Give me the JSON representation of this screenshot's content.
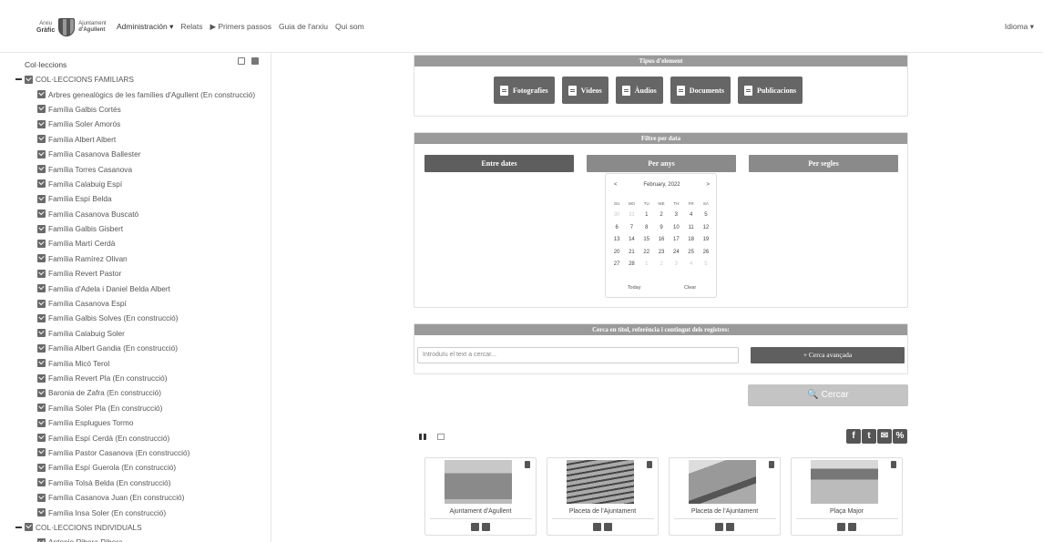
{
  "navbar": {
    "logo_line1": "Arxiu",
    "logo_line2": "Gràfic",
    "logo_line3": "Ajuntament",
    "logo_line4": "d'Agullent",
    "admin": "Administración ▾",
    "links": [
      "Relats",
      "▶ Primers passos",
      "Guia de l'arxiu",
      "Qui som"
    ],
    "language": "Idioma ▾"
  },
  "sidebar": {
    "title": "Col·leccions",
    "group1": "COL·LECCIONS FAMILIARS",
    "group1_items": [
      "Arbres genealògics de les famílies d'Agullent (En construcció)",
      "Família Galbis Cortés",
      "Família Soler Amorós",
      "Família Albert Albert",
      "Família Casanova Ballester",
      "Família Torres Casanova",
      "Família Calabuig Espí",
      "Família Espí Belda",
      "Família Casanova Buscató",
      "Família Galbis Gisbert",
      "Família Martí Cerdà",
      "Família Ramírez Olivan",
      "Família Revert Pastor",
      "Família d'Adela i Daniel Belda Albert",
      "Família Casanova Espí",
      "Família Galbis Solves (En construcció)",
      "Família Calabuig Soler",
      "Família Albert Gandia (En construcció)",
      "Família Micó Terol",
      "Família Revert Pla (En construcció)",
      "Baronia de Zafra (En construcció)",
      "Família Soler Pla (En construcció)",
      "Família Esplugues Tormo",
      "Família Espí Cerdà (En construcció)",
      "Família Pastor Casanova (En construcció)",
      "Família Espí Guerola (En construcció)",
      "Família Tolsà Belda (En construcció)",
      "Família Casanova Juan (En construcció)",
      "Família Insa Soler (En construcció)"
    ],
    "group2": "COL·LECCIONS INDIVIDUALS",
    "group2_items": [
      "Antonio Ribera Ribera"
    ]
  },
  "types": {
    "header": "Tipus d'element",
    "buttons": [
      "Fotografies",
      "Vídeos",
      "Àudios",
      "Documents",
      "Publicacions"
    ]
  },
  "date_filter": {
    "header": "Filtre per data",
    "tabs": [
      "Entre dates",
      "Per anys",
      "Per segles"
    ]
  },
  "calendar": {
    "prev": "<",
    "next": ">",
    "month": "February, 2022",
    "dows": [
      "SU",
      "MO",
      "TU",
      "WE",
      "TH",
      "FR",
      "SA"
    ],
    "days": [
      {
        "d": "30",
        "m": true
      },
      {
        "d": "31",
        "m": true
      },
      {
        "d": "1"
      },
      {
        "d": "2"
      },
      {
        "d": "3"
      },
      {
        "d": "4"
      },
      {
        "d": "5"
      },
      {
        "d": "6"
      },
      {
        "d": "7"
      },
      {
        "d": "8"
      },
      {
        "d": "9"
      },
      {
        "d": "10"
      },
      {
        "d": "11"
      },
      {
        "d": "12"
      },
      {
        "d": "13"
      },
      {
        "d": "14"
      },
      {
        "d": "15"
      },
      {
        "d": "16"
      },
      {
        "d": "17"
      },
      {
        "d": "18"
      },
      {
        "d": "19"
      },
      {
        "d": "20"
      },
      {
        "d": "21"
      },
      {
        "d": "22"
      },
      {
        "d": "23"
      },
      {
        "d": "24"
      },
      {
        "d": "25"
      },
      {
        "d": "26"
      },
      {
        "d": "27"
      },
      {
        "d": "28"
      },
      {
        "d": "1",
        "m": true
      },
      {
        "d": "2",
        "m": true
      },
      {
        "d": "3",
        "m": true
      },
      {
        "d": "4",
        "m": true
      },
      {
        "d": "5",
        "m": true
      }
    ],
    "today": "Today",
    "clear": "Clear"
  },
  "search": {
    "header": "Cerca en títol, referència i contingut dels registres:",
    "placeholder": "Introduïu el text a cercar...",
    "advanced": "+ Cerca avançada",
    "submit": "🔍 Cercar"
  },
  "share": [
    "f",
    "t",
    "✉",
    "%"
  ],
  "cards": [
    {
      "title": "Ajuntament d'Agullent"
    },
    {
      "title": "Placeta de l'Ajuntament"
    },
    {
      "title": "Placeta de l'Ajuntament"
    },
    {
      "title": "Plaça Major"
    }
  ]
}
